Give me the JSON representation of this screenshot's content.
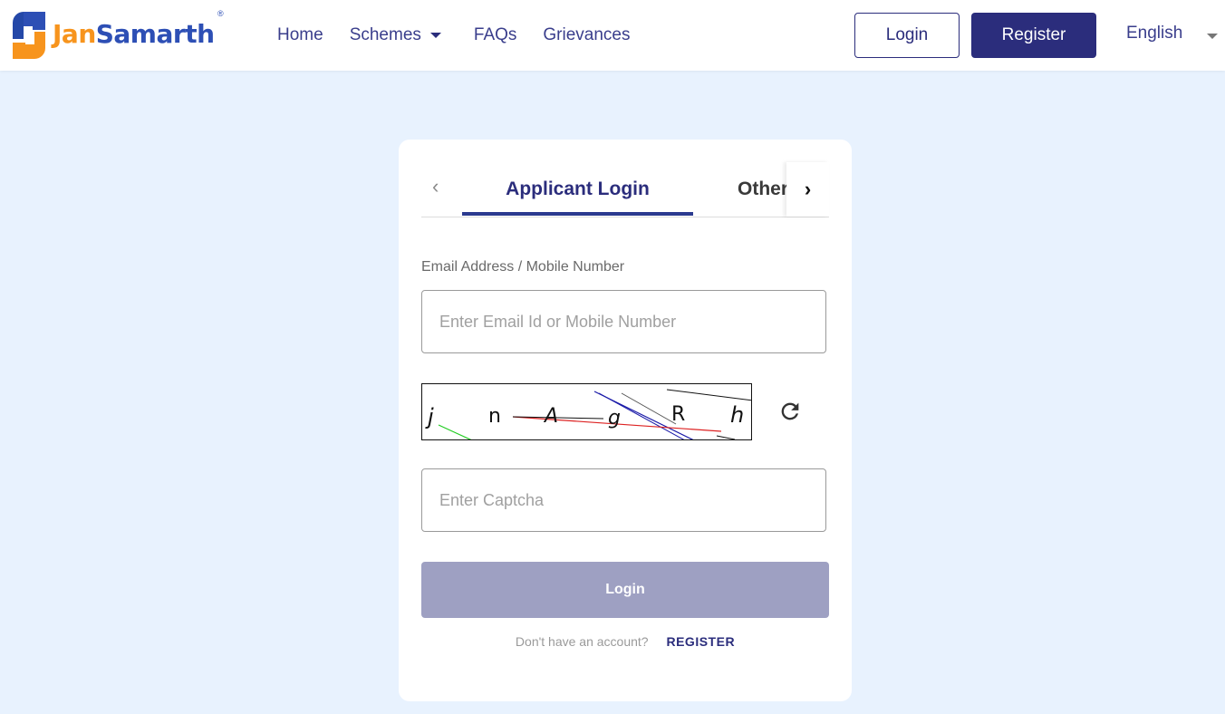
{
  "brand": {
    "name_part1": "Jan",
    "name_part2": "Samarth",
    "registered_mark": "®",
    "colors": {
      "orange": "#f7941d",
      "blue": "#2d4fb5",
      "primary": "#2b2d7c",
      "page_bg": "#e8f2fe"
    }
  },
  "nav": {
    "items": [
      {
        "label": "Home"
      },
      {
        "label": "Schemes",
        "has_dropdown": true
      },
      {
        "label": "FAQs"
      },
      {
        "label": "Grievances"
      }
    ]
  },
  "header_actions": {
    "login_label": "Login",
    "register_label": "Register",
    "language": "English"
  },
  "login_card": {
    "tabs": [
      {
        "label": "Applicant Login",
        "active": true
      },
      {
        "label": "Other",
        "active": false
      }
    ],
    "email_label": "Email Address / Mobile Number",
    "email_placeholder": "Enter Email Id or Mobile Number",
    "email_value": "",
    "captcha_text": "jnAgRh",
    "captcha_placeholder": "Enter Captcha",
    "captcha_value": "",
    "login_button": "Login",
    "no_account_text": "Don't have an account?",
    "register_link": "REGISTER"
  }
}
